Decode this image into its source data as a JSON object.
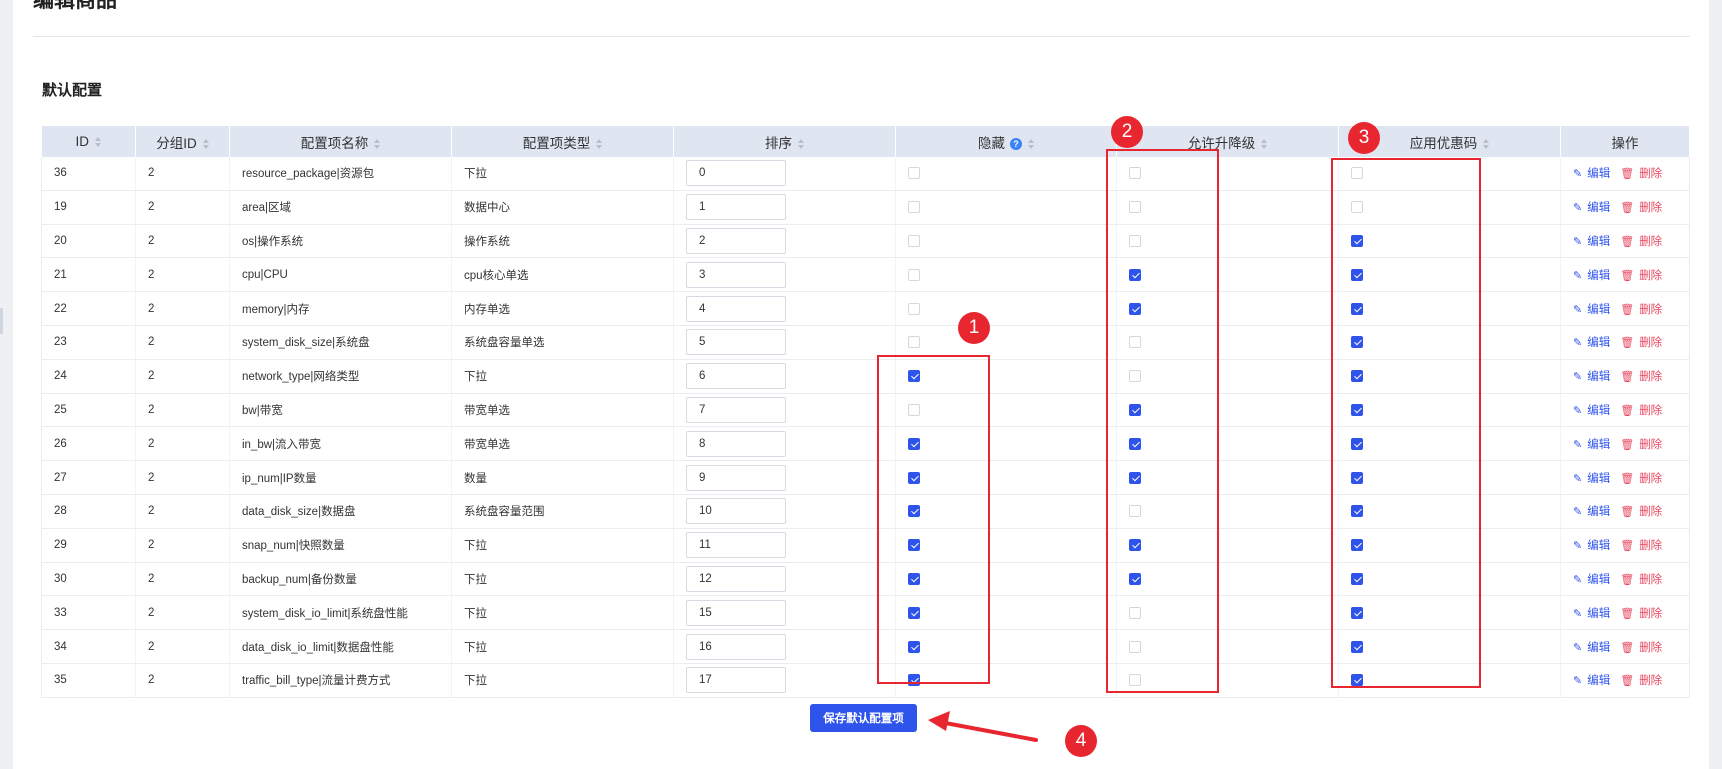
{
  "page": {
    "title": "编辑商品",
    "section_title": "默认配置",
    "save_button_label": "保存默认配置项"
  },
  "table": {
    "headers": {
      "id": "ID",
      "group_id": "分组ID",
      "name": "配置项名称",
      "type": "配置项类型",
      "sort": "排序",
      "hidden": "隐藏",
      "upgrade": "允许升降级",
      "coupon": "应用优惠码",
      "actions": "操作"
    },
    "edit_label": "编辑",
    "delete_label": "删除",
    "rows": [
      {
        "id": "36",
        "group_id": "2",
        "name": "resource_package|资源包",
        "type": "下拉",
        "sort": "0",
        "hidden": false,
        "upgrade": false,
        "coupon": false
      },
      {
        "id": "19",
        "group_id": "2",
        "name": "area|区域",
        "type": "数据中心",
        "sort": "1",
        "hidden": false,
        "upgrade": false,
        "coupon": false
      },
      {
        "id": "20",
        "group_id": "2",
        "name": "os|操作系统",
        "type": "操作系统",
        "sort": "2",
        "hidden": false,
        "upgrade": false,
        "coupon": true
      },
      {
        "id": "21",
        "group_id": "2",
        "name": "cpu|CPU",
        "type": "cpu核心单选",
        "sort": "3",
        "hidden": false,
        "upgrade": true,
        "coupon": true
      },
      {
        "id": "22",
        "group_id": "2",
        "name": "memory|内存",
        "type": "内存单选",
        "sort": "4",
        "hidden": false,
        "upgrade": true,
        "coupon": true
      },
      {
        "id": "23",
        "group_id": "2",
        "name": "system_disk_size|系统盘",
        "type": "系统盘容量单选",
        "sort": "5",
        "hidden": false,
        "upgrade": false,
        "coupon": true
      },
      {
        "id": "24",
        "group_id": "2",
        "name": "network_type|网络类型",
        "type": "下拉",
        "sort": "6",
        "hidden": true,
        "upgrade": false,
        "coupon": true
      },
      {
        "id": "25",
        "group_id": "2",
        "name": "bw|带宽",
        "type": "带宽单选",
        "sort": "7",
        "hidden": false,
        "upgrade": true,
        "coupon": true
      },
      {
        "id": "26",
        "group_id": "2",
        "name": "in_bw|流入带宽",
        "type": "带宽单选",
        "sort": "8",
        "hidden": true,
        "upgrade": true,
        "coupon": true
      },
      {
        "id": "27",
        "group_id": "2",
        "name": "ip_num|IP数量",
        "type": "数量",
        "sort": "9",
        "hidden": true,
        "upgrade": true,
        "coupon": true
      },
      {
        "id": "28",
        "group_id": "2",
        "name": "data_disk_size|数据盘",
        "type": "系统盘容量范围",
        "sort": "10",
        "hidden": true,
        "upgrade": false,
        "coupon": true
      },
      {
        "id": "29",
        "group_id": "2",
        "name": "snap_num|快照数量",
        "type": "下拉",
        "sort": "11",
        "hidden": true,
        "upgrade": true,
        "coupon": true
      },
      {
        "id": "30",
        "group_id": "2",
        "name": "backup_num|备份数量",
        "type": "下拉",
        "sort": "12",
        "hidden": true,
        "upgrade": true,
        "coupon": true
      },
      {
        "id": "33",
        "group_id": "2",
        "name": "system_disk_io_limit|系统盘性能",
        "type": "下拉",
        "sort": "15",
        "hidden": true,
        "upgrade": false,
        "coupon": true
      },
      {
        "id": "34",
        "group_id": "2",
        "name": "data_disk_io_limit|数据盘性能",
        "type": "下拉",
        "sort": "16",
        "hidden": true,
        "upgrade": false,
        "coupon": true
      },
      {
        "id": "35",
        "group_id": "2",
        "name": "traffic_bill_type|流量计费方式",
        "type": "下拉",
        "sort": "17",
        "hidden": true,
        "upgrade": false,
        "coupon": true
      }
    ]
  },
  "annotations": {
    "badges": [
      "1",
      "2",
      "3",
      "4"
    ],
    "color": "#e8262f"
  },
  "colors": {
    "primary": "#2f54eb",
    "danger": "#e8475f",
    "header_bg": "#dfe5f1"
  }
}
